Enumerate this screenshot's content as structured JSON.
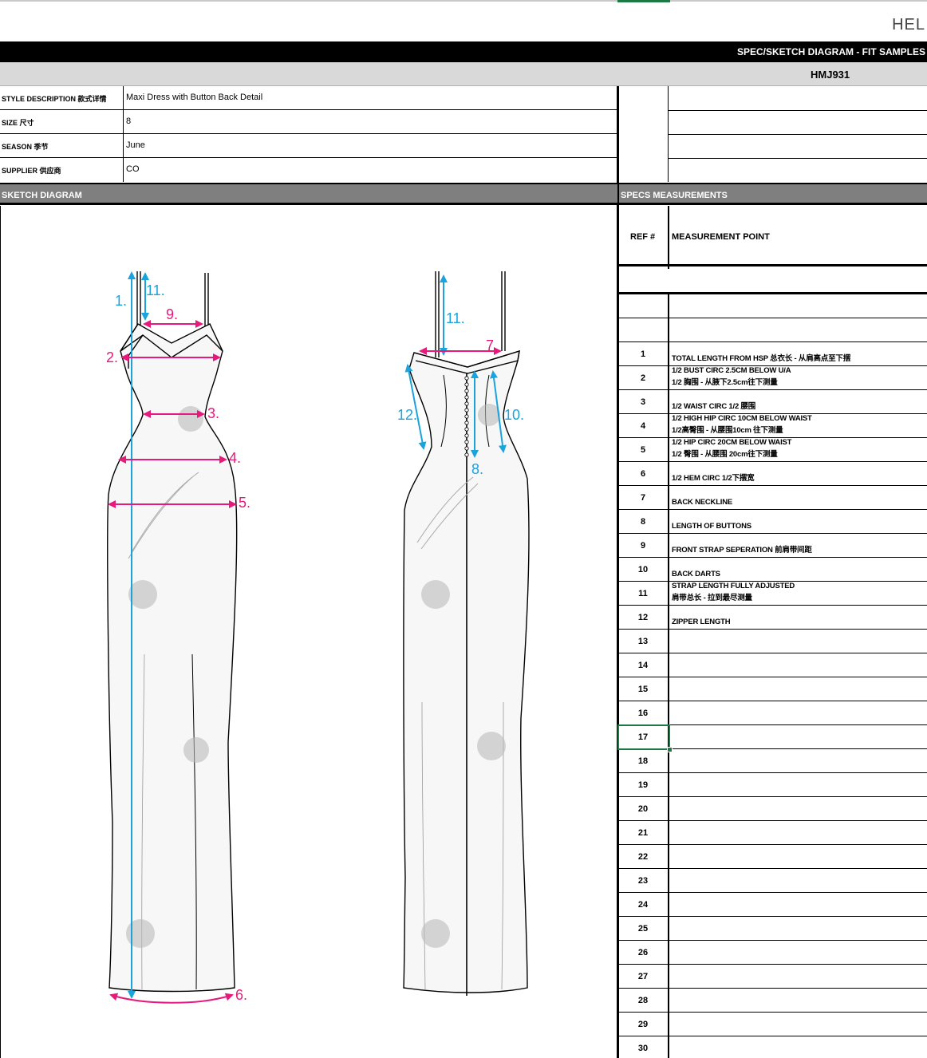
{
  "brand": "HEL",
  "sheet_title": "SPEC/SKETCH DIAGRAM - FIT SAMPLES",
  "style_code": "HMJ931",
  "info": [
    {
      "label": "STYLE DESCRIPTION 款式详情",
      "value": "Maxi Dress with Button Back Detail"
    },
    {
      "label": "SIZE 尺寸",
      "value": "8"
    },
    {
      "label": "SEASON 季节",
      "value": "June"
    },
    {
      "label": "SUPPLIER 供应商",
      "value": "CO"
    }
  ],
  "sketch_title": "SKETCH DIAGRAM",
  "specs_title": "SPECS MEASUREMENTS",
  "spec_headers": {
    "ref": "REF #",
    "point": "MEASUREMENT POINT"
  },
  "sketch_labels": {
    "front": [
      "1.",
      "2.",
      "3.",
      "4.",
      "5.",
      "6.",
      "9.",
      "11."
    ],
    "back": [
      "7.",
      "8.",
      "10.",
      "11.",
      "12."
    ]
  },
  "colors": {
    "measure_blue": "#1aa3dc",
    "measure_pink": "#e6197d",
    "selection_green": "#1e7a45"
  },
  "measurements": [
    {
      "ref": "1",
      "lines": [
        "TOTAL LENGTH FROM HSP 总衣长 - 从肩高点至下摆"
      ]
    },
    {
      "ref": "2",
      "lines": [
        "1/2 BUST CIRC 2.5CM BELOW U/A",
        "1/2 胸围 - 从腋下2.5cm往下测量"
      ]
    },
    {
      "ref": "3",
      "lines": [
        "1/2 WAIST CIRC 1/2 腰围"
      ]
    },
    {
      "ref": "4",
      "lines": [
        "1/2 HIGH HIP CIRC 10CM BELOW WAIST",
        "1/2高臀围 - 从腰围10cm 往下测量"
      ]
    },
    {
      "ref": "5",
      "lines": [
        "1/2 HIP CIRC 20CM BELOW WAIST",
        "1/2 臀围 - 从腰围 20cm往下测量"
      ]
    },
    {
      "ref": "6",
      "lines": [
        "1/2 HEM CIRC 1/2下摆宽"
      ]
    },
    {
      "ref": "7",
      "lines": [
        "BACK NECKLINE"
      ]
    },
    {
      "ref": "8",
      "lines": [
        "LENGTH OF BUTTONS"
      ]
    },
    {
      "ref": "9",
      "lines": [
        "FRONT STRAP SEPERATION 前肩带间距"
      ]
    },
    {
      "ref": "10",
      "lines": [
        "BACK DARTS"
      ]
    },
    {
      "ref": "11",
      "lines": [
        "STRAP LENGTH FULLY ADJUSTED",
        "肩带总长 - 拉到最尽测量"
      ]
    },
    {
      "ref": "12",
      "lines": [
        "ZIPPER LENGTH"
      ]
    },
    {
      "ref": "13",
      "lines": []
    },
    {
      "ref": "14",
      "lines": []
    },
    {
      "ref": "15",
      "lines": []
    },
    {
      "ref": "16",
      "lines": []
    },
    {
      "ref": "17",
      "lines": []
    },
    {
      "ref": "18",
      "lines": []
    },
    {
      "ref": "19",
      "lines": []
    },
    {
      "ref": "20",
      "lines": []
    },
    {
      "ref": "21",
      "lines": []
    },
    {
      "ref": "22",
      "lines": []
    },
    {
      "ref": "23",
      "lines": []
    },
    {
      "ref": "24",
      "lines": []
    },
    {
      "ref": "25",
      "lines": []
    },
    {
      "ref": "26",
      "lines": []
    },
    {
      "ref": "27",
      "lines": []
    },
    {
      "ref": "28",
      "lines": []
    },
    {
      "ref": "29",
      "lines": []
    },
    {
      "ref": "30",
      "lines": []
    }
  ],
  "selected_ref": "17"
}
